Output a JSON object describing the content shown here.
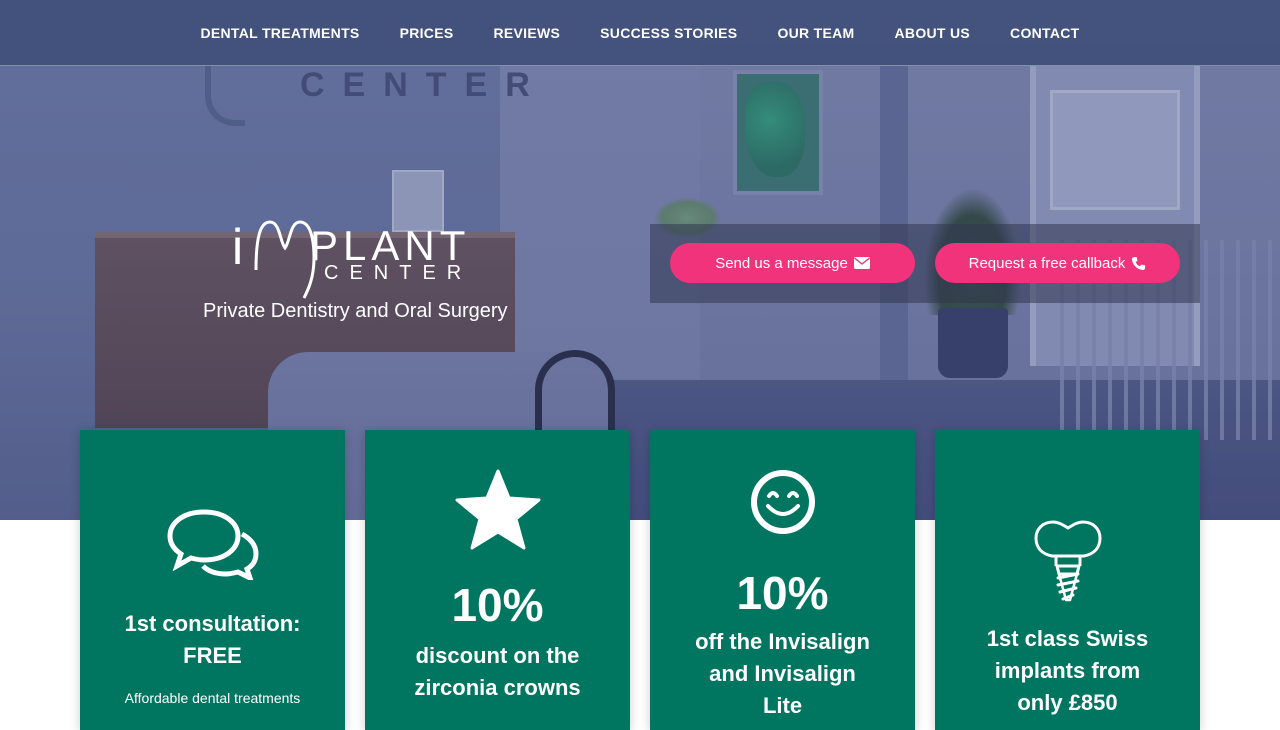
{
  "nav": {
    "items": [
      {
        "label": "DENTAL TREATMENTS"
      },
      {
        "label": "PRICES"
      },
      {
        "label": "REVIEWS"
      },
      {
        "label": "SUCCESS STORIES"
      },
      {
        "label": "OUR TEAM"
      },
      {
        "label": "ABOUT US"
      },
      {
        "label": "CONTACT"
      }
    ]
  },
  "hero": {
    "logo": {
      "i": "i",
      "plant": "PLANT",
      "center": "CENTER"
    },
    "tagline": "Private Dentistry and Oral Surgery",
    "sign_text": "CENTER",
    "buttons": {
      "message": {
        "label": "Send us a message",
        "icon": "envelope-icon"
      },
      "callback": {
        "label": "Request a free callback",
        "icon": "phone-icon"
      }
    }
  },
  "cards": [
    {
      "icon": "chat-bubbles-icon",
      "title": "1st consultation: FREE",
      "title_line1": "1st consultation:",
      "title_line2": "FREE",
      "desc": "Affordable dental treatments"
    },
    {
      "icon": "star-icon",
      "big": "10%",
      "title_line1": "discount on the",
      "title_line2": "zirconia crowns"
    },
    {
      "icon": "smiley-icon",
      "big": "10%",
      "title_line1": "off the Invisalign",
      "title_line2": "and Invisalign",
      "title_line3": "Lite"
    },
    {
      "icon": "dental-implant-icon",
      "title_line1": "1st class Swiss",
      "title_line2": "implants from",
      "title_line3": "only £850"
    }
  ],
  "colors": {
    "nav_bg": "#40507a",
    "cta_pink": "#f0337a",
    "card_green": "#007560"
  }
}
